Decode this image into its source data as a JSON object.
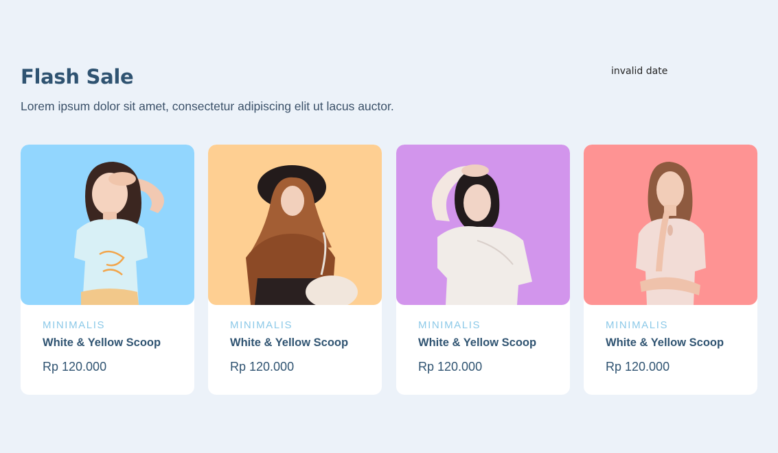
{
  "header": {
    "title": "Flash Sale",
    "subtitle": "Lorem ipsum dolor sit amet, consectetur adipiscing elit ut lacus auctor.",
    "countdown": "invalid date"
  },
  "products": [
    {
      "image_bg": "#92d6fe",
      "figure": "woman-in-white-t-shirt",
      "brand": "MINIMALIS",
      "name": "White & Yellow Scoop",
      "price": "Rp 120.000"
    },
    {
      "image_bg": "#fecf92",
      "figure": "woman-in-hijab-and-hat",
      "brand": "MINIMALIS",
      "name": "White & Yellow Scoop",
      "price": "Rp 120.000"
    },
    {
      "image_bg": "#d295ec",
      "figure": "woman-in-white-top",
      "brand": "MINIMALIS",
      "name": "White & Yellow Scoop",
      "price": "Rp 120.000"
    },
    {
      "image_bg": "#fe9393",
      "figure": "woman-in-pink-blouse",
      "brand": "MINIMALIS",
      "name": "White & Yellow Scoop",
      "price": "Rp 120.000"
    }
  ]
}
